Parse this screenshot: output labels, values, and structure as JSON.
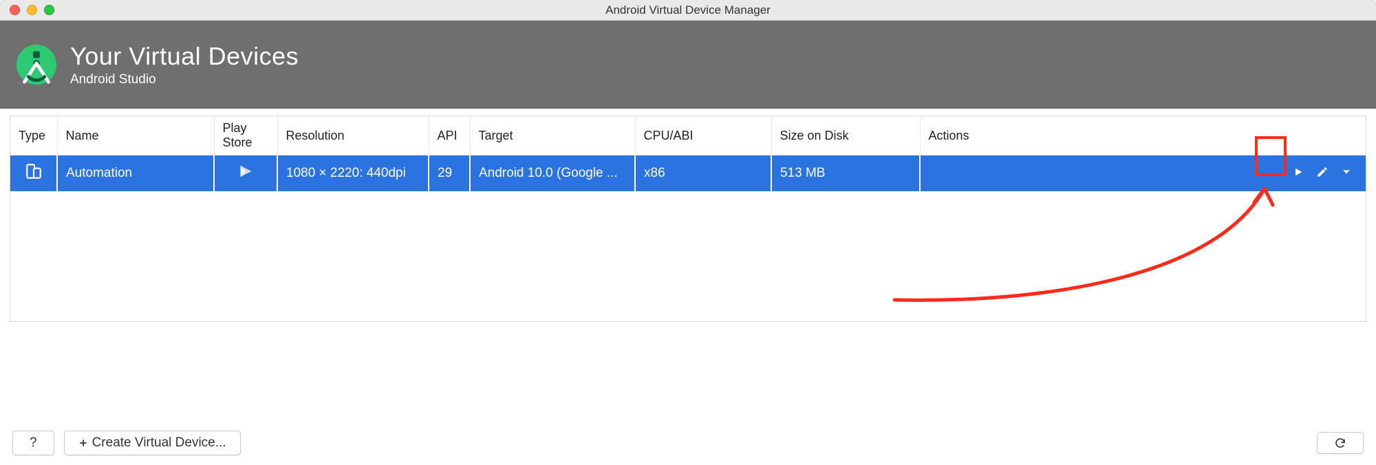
{
  "window": {
    "title": "Android Virtual Device Manager"
  },
  "header": {
    "title": "Your Virtual Devices",
    "subtitle": "Android Studio"
  },
  "table": {
    "columns": {
      "type": "Type",
      "name": "Name",
      "play_store": "Play Store",
      "resolution": "Resolution",
      "api": "API",
      "target": "Target",
      "cpu_abi": "CPU/ABI",
      "size_on_disk": "Size on Disk",
      "actions": "Actions"
    },
    "rows": [
      {
        "type_icon": "phone-icon",
        "name": "Automation",
        "play_store_icon": "play-store-icon",
        "resolution": "1080 × 2220: 440dpi",
        "api": "29",
        "target": "Android 10.0 (Google ...",
        "cpu_abi": "x86",
        "size_on_disk": "513 MB"
      }
    ]
  },
  "footer": {
    "help_label": "?",
    "create_label": "Create Virtual Device..."
  }
}
